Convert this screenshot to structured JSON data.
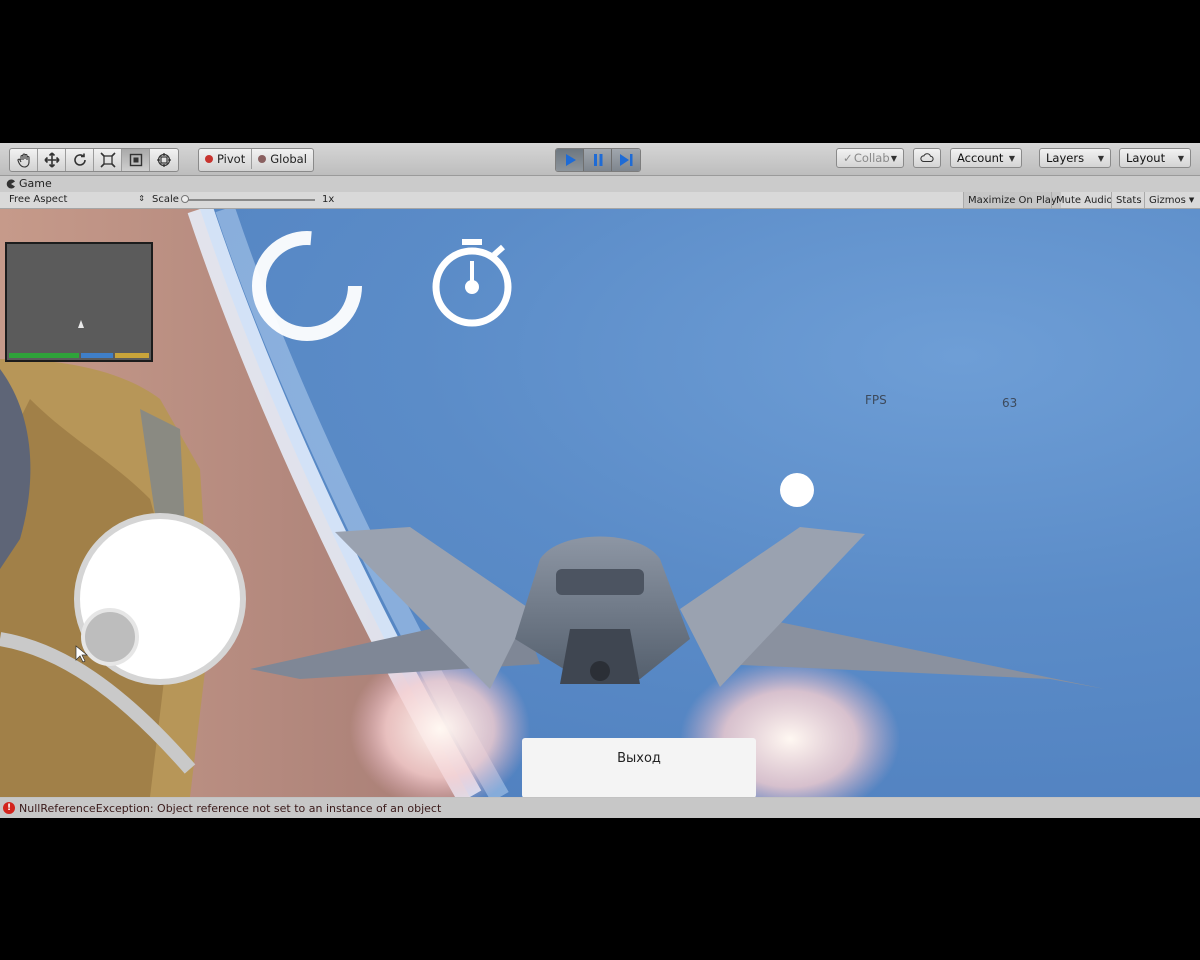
{
  "toolbar": {
    "tools": [
      "hand-tool",
      "move-tool",
      "rotate-tool",
      "scale-tool",
      "rect-tool",
      "transform-tool"
    ],
    "pivot_label": "Pivot",
    "global_label": "Global",
    "collab_label": "Collab",
    "account_label": "Account",
    "layers_label": "Layers",
    "layout_label": "Layout"
  },
  "game_view": {
    "tab_label": "Game",
    "aspect_label": "Free Aspect",
    "scale_label": "Scale",
    "scale_value": "1x",
    "maximize_label": "Maximize On Play",
    "mute_label": "Mute Audio",
    "stats_label": "Stats",
    "gizmos_label": "Gizmos"
  },
  "hud": {
    "fps_label": "FPS",
    "fps_value": "63",
    "exit_label": "Выход",
    "minimap_bar_colors": [
      "#2fa33a",
      "#3f7fc8",
      "#c9a43a"
    ]
  },
  "console": {
    "error_message": "NullReferenceException: Object reference not set to an instance of an object"
  },
  "colors": {
    "play_accent": "#1e6bd6",
    "error": "#d3241d"
  }
}
